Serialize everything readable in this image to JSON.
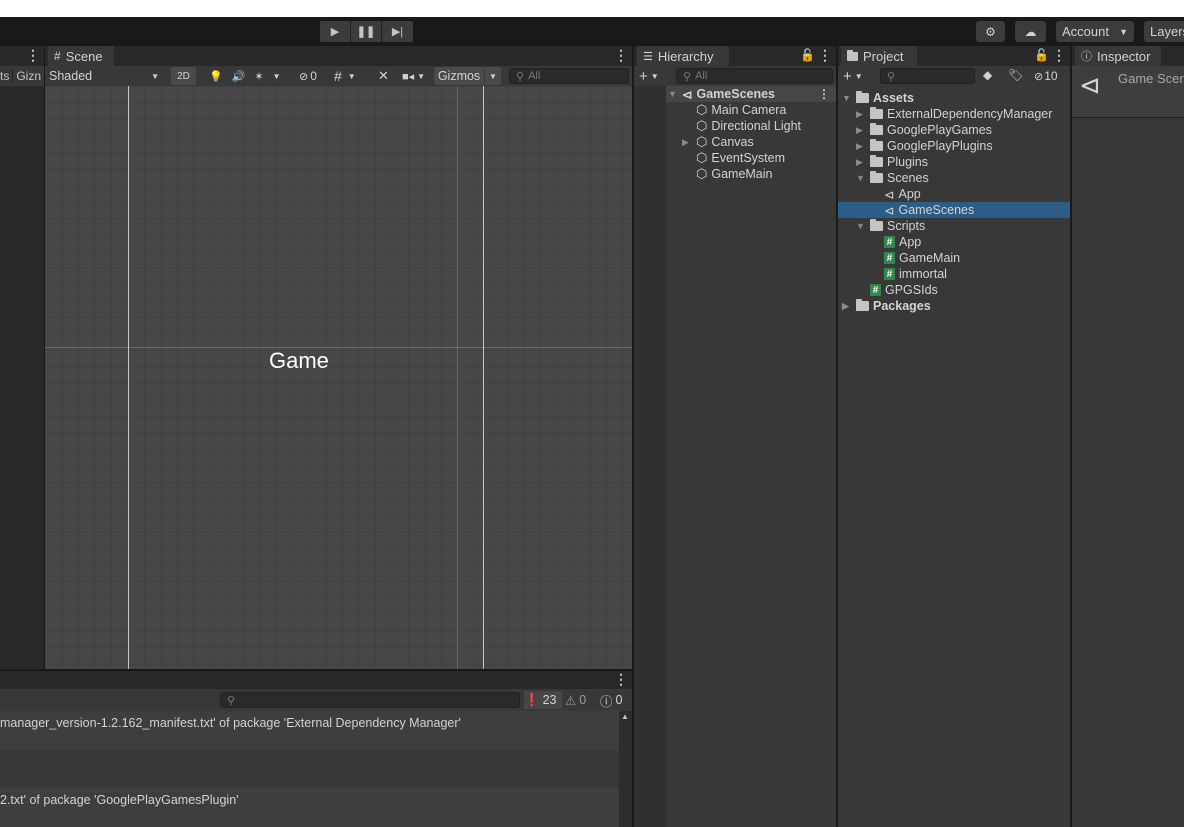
{
  "toolbar": {
    "account_label": "Account",
    "layers_label": "Layers"
  },
  "left_panel": {
    "tab_partial_1": "ts",
    "tab_partial_2": "Gizn"
  },
  "scene": {
    "tab_label": "Scene",
    "shading_mode": "Shaded",
    "btn_2d": "2D",
    "hidden_count": "0",
    "gizmos_label": "Gizmos",
    "search_placeholder": "All",
    "canvas_text": "Game"
  },
  "hierarchy": {
    "tab_label": "Hierarchy",
    "search_placeholder": "All",
    "root": "GameScenes",
    "items": [
      {
        "label": "Main Camera",
        "expandable": false
      },
      {
        "label": "Directional Light",
        "expandable": false
      },
      {
        "label": "Canvas",
        "expandable": true
      },
      {
        "label": "EventSystem",
        "expandable": false
      },
      {
        "label": "GameMain",
        "expandable": false
      }
    ]
  },
  "project": {
    "tab_label": "Project",
    "hidden_count": "10",
    "tree": {
      "assets": "Assets",
      "external_dep": "ExternalDependencyManager",
      "gpg": "GooglePlayGames",
      "gpp": "GooglePlayPlugins",
      "plugins": "Plugins",
      "scenes": "Scenes",
      "scene_app": "App",
      "scene_gamescenes": "GameScenes",
      "scripts": "Scripts",
      "script_app": "App",
      "script_gamemain": "GameMain",
      "script_immortal": "immortal",
      "gpgsids": "GPGSIds",
      "packages": "Packages"
    }
  },
  "inspector": {
    "tab_label": "Inspector",
    "object_name": "Game Scer"
  },
  "console": {
    "error_count": "23",
    "warning_count": "0",
    "info_count": "0",
    "lines": [
      "manager_version-1.2.162_manifest.txt' of package 'External Dependency Manager'",
      "",
      "2.txt' of package 'GooglePlayGamesPlugin'"
    ]
  }
}
